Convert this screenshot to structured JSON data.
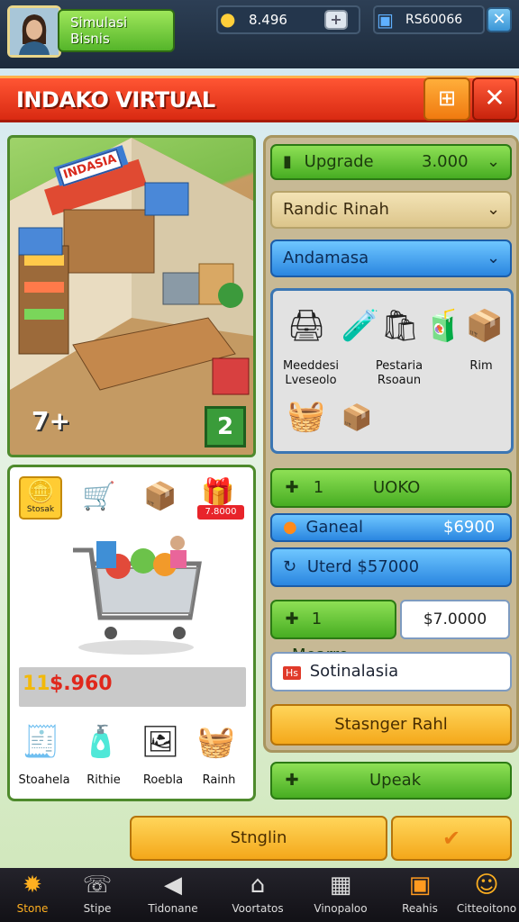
{
  "profile": {
    "line1": "Simulasi",
    "line2": "Bisnis"
  },
  "currency": {
    "coins": "8.496",
    "cash": "RS60066"
  },
  "banner": {
    "title": "INDAKO VIRTUAL"
  },
  "scene": {
    "sign": "INDASIA",
    "level_left": "7+",
    "level_right": "2"
  },
  "side": {
    "upgrade_label": "Upgrade",
    "upgrade_value": "3.000",
    "dropdown1": "Randic Rinah",
    "dropdown2": "Andamasa",
    "items": [
      {
        "icon": "cash-register-icon",
        "glyph": "🖨"
      },
      {
        "icon": "test-tube-icon",
        "glyph": "🧪"
      },
      {
        "icon": "shopping-bag-icon",
        "glyph": "🛍"
      },
      {
        "icon": "drink-icon",
        "glyph": "🧃"
      },
      {
        "icon": "box-icon",
        "glyph": "📦"
      }
    ],
    "item_labels": [
      "Meeddesi Lveseolo",
      "Pestaria Rsoaun",
      "Rim"
    ],
    "extra_items": [
      {
        "icon": "fruit-crate-icon",
        "glyph": "🧺"
      },
      {
        "icon": "package-icon",
        "glyph": "📦"
      }
    ],
    "btn_uoko": "UOKO",
    "btn_uoko_num": "1",
    "ganeal_label": "Ganeal",
    "ganeal_value": "$6900",
    "uterd": "Uterd $57000",
    "mearre_num": "1",
    "mearre_label": "Mearre",
    "mearre_value": "$7.0000",
    "sotinaisia": "Sotinalasia",
    "sotinaisia_tag": "Hs",
    "stasager": "Stasnger Rahl",
    "upeak": "Upeak"
  },
  "shop": {
    "top_icons": [
      {
        "icon": "coin-badge-icon",
        "glyph": "🪙",
        "label": "Stosak"
      },
      {
        "icon": "cart-items-icon",
        "glyph": "🛒"
      },
      {
        "icon": "box-icon",
        "glyph": "📦"
      },
      {
        "icon": "gift-box-icon",
        "glyph": "🎁",
        "label": "7.8000"
      }
    ],
    "price_num": "11",
    "price": "$.960",
    "bottom": [
      {
        "icon": "register-icon",
        "glyph": "🧾",
        "label": "Stoahela"
      },
      {
        "icon": "bottle-icon",
        "glyph": "🧴",
        "label": "Rithie"
      },
      {
        "icon": "picture-frame-icon",
        "glyph": "🖼",
        "label": "Roebla"
      },
      {
        "icon": "basket-icon",
        "glyph": "🧺",
        "label": "Rainh"
      }
    ]
  },
  "bottom_buttons": {
    "main": "Stnglin"
  },
  "nav": [
    {
      "icon": "star-icon",
      "glyph": "✹",
      "label": "Stone"
    },
    {
      "icon": "phone-icon",
      "glyph": "☏",
      "label": "Stipe"
    },
    {
      "icon": "triangle-icon",
      "glyph": "◀",
      "label": "Tidonane"
    },
    {
      "icon": "home-icon",
      "glyph": "⌂",
      "label": "Voortatos"
    },
    {
      "icon": "tile-icon",
      "glyph": "▦",
      "label": "Vinopaloo"
    },
    {
      "icon": "store-icon",
      "glyph": "▣",
      "label": "Reahis"
    },
    {
      "icon": "profile-icon",
      "glyph": "☺",
      "label": "Citteoitono"
    }
  ],
  "colors": {
    "accent_green": "#47ad22",
    "accent_blue": "#2a86e0",
    "banner_red": "#d92a12",
    "gold": "#f4a81a"
  }
}
